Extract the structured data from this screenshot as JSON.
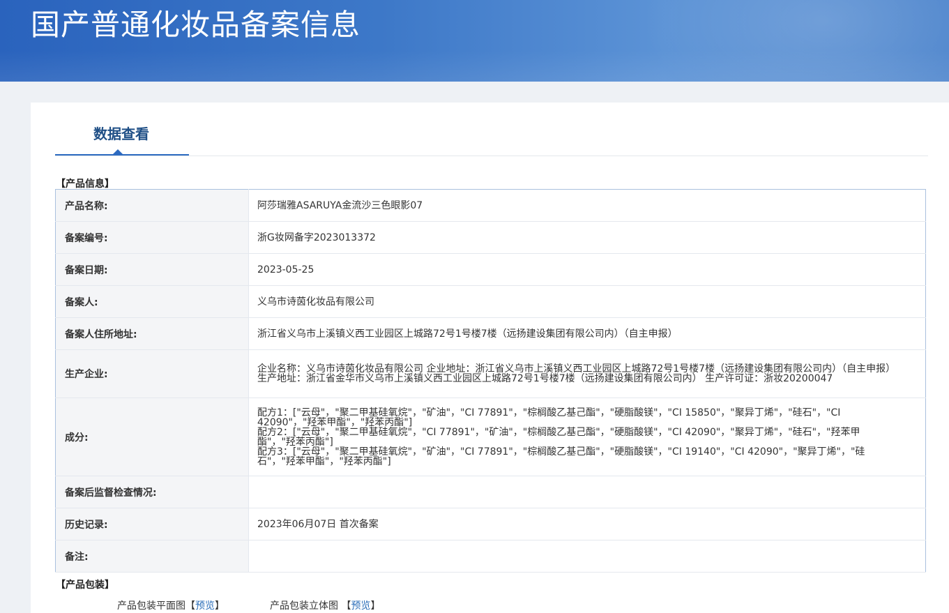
{
  "header": {
    "title": "国产普通化妆品备案信息"
  },
  "tab": {
    "label": "数据查看"
  },
  "sections": {
    "product_info": "【产品信息】",
    "packaging": "【产品包装】"
  },
  "product_table": [
    {
      "label": "产品名称:",
      "value": "阿莎瑞雅ASARUYA金流沙三色眼影07"
    },
    {
      "label": "备案编号:",
      "value": "浙G妆网备字2023013372"
    },
    {
      "label": "备案日期:",
      "value": "2023-05-25"
    },
    {
      "label": "备案人:",
      "value": "义乌市诗茵化妆品有限公司"
    },
    {
      "label": "备案人住所地址:",
      "value": "浙江省义乌市上溪镇义西工业园区上城路72号1号楼7楼（远扬建设集团有限公司内）（自主申报）"
    },
    {
      "label": "生产企业:",
      "value": "企业名称：义乌市诗茵化妆品有限公司 企业地址：浙江省义乌市上溪镇义西工业园区上城路72号1号楼7楼（远扬建设集团有限公司内）（自主申报） 生产地址：浙江省金华市义乌市上溪镇义西工业园区上城路72号1号楼7楼（远扬建设集团有限公司内） 生产许可证：浙妆20200047"
    },
    {
      "label": "成分:",
      "lines": [
        "配方1：[\"云母\"，\"聚二甲基硅氧烷\"，\"矿油\"，\"CI 77891\"，\"棕榈酸乙基己酯\"，\"硬脂酸镁\"，\"CI 15850\"，\"聚异丁烯\"，\"硅石\"，\"CI 42090\"，\"羟苯甲酯\"，\"羟苯丙酯\"]",
        "配方2：[\"云母\"，\"聚二甲基硅氧烷\"，\"CI 77891\"，\"矿油\"，\"棕榈酸乙基己酯\"，\"硬脂酸镁\"，\"CI 42090\"，\"聚异丁烯\"，\"硅石\"，\"羟苯甲酯\"，\"羟苯丙酯\"]",
        "配方3：[\"云母\"，\"聚二甲基硅氧烷\"，\"矿油\"，\"CI 77891\"，\"棕榈酸乙基己酯\"，\"硬脂酸镁\"，\"CI 19140\"，\"CI 42090\"，\"聚异丁烯\"，\"硅石\"，\"羟苯甲酯\"，\"羟苯丙酯\"]"
      ]
    },
    {
      "label": "备案后监督检查情况:",
      "value": ""
    },
    {
      "label": "历史记录:",
      "value": "2023年06月07日 首次备案"
    },
    {
      "label": "备注:",
      "value": ""
    }
  ],
  "packaging": {
    "flat": {
      "label": "产品包装平面图",
      "bracket_open": "【",
      "link": "预览",
      "bracket_close": "】"
    },
    "solid": {
      "label": "产品包装立体图",
      "bracket_open": "【",
      "link": "预览",
      "bracket_close": "】"
    }
  }
}
